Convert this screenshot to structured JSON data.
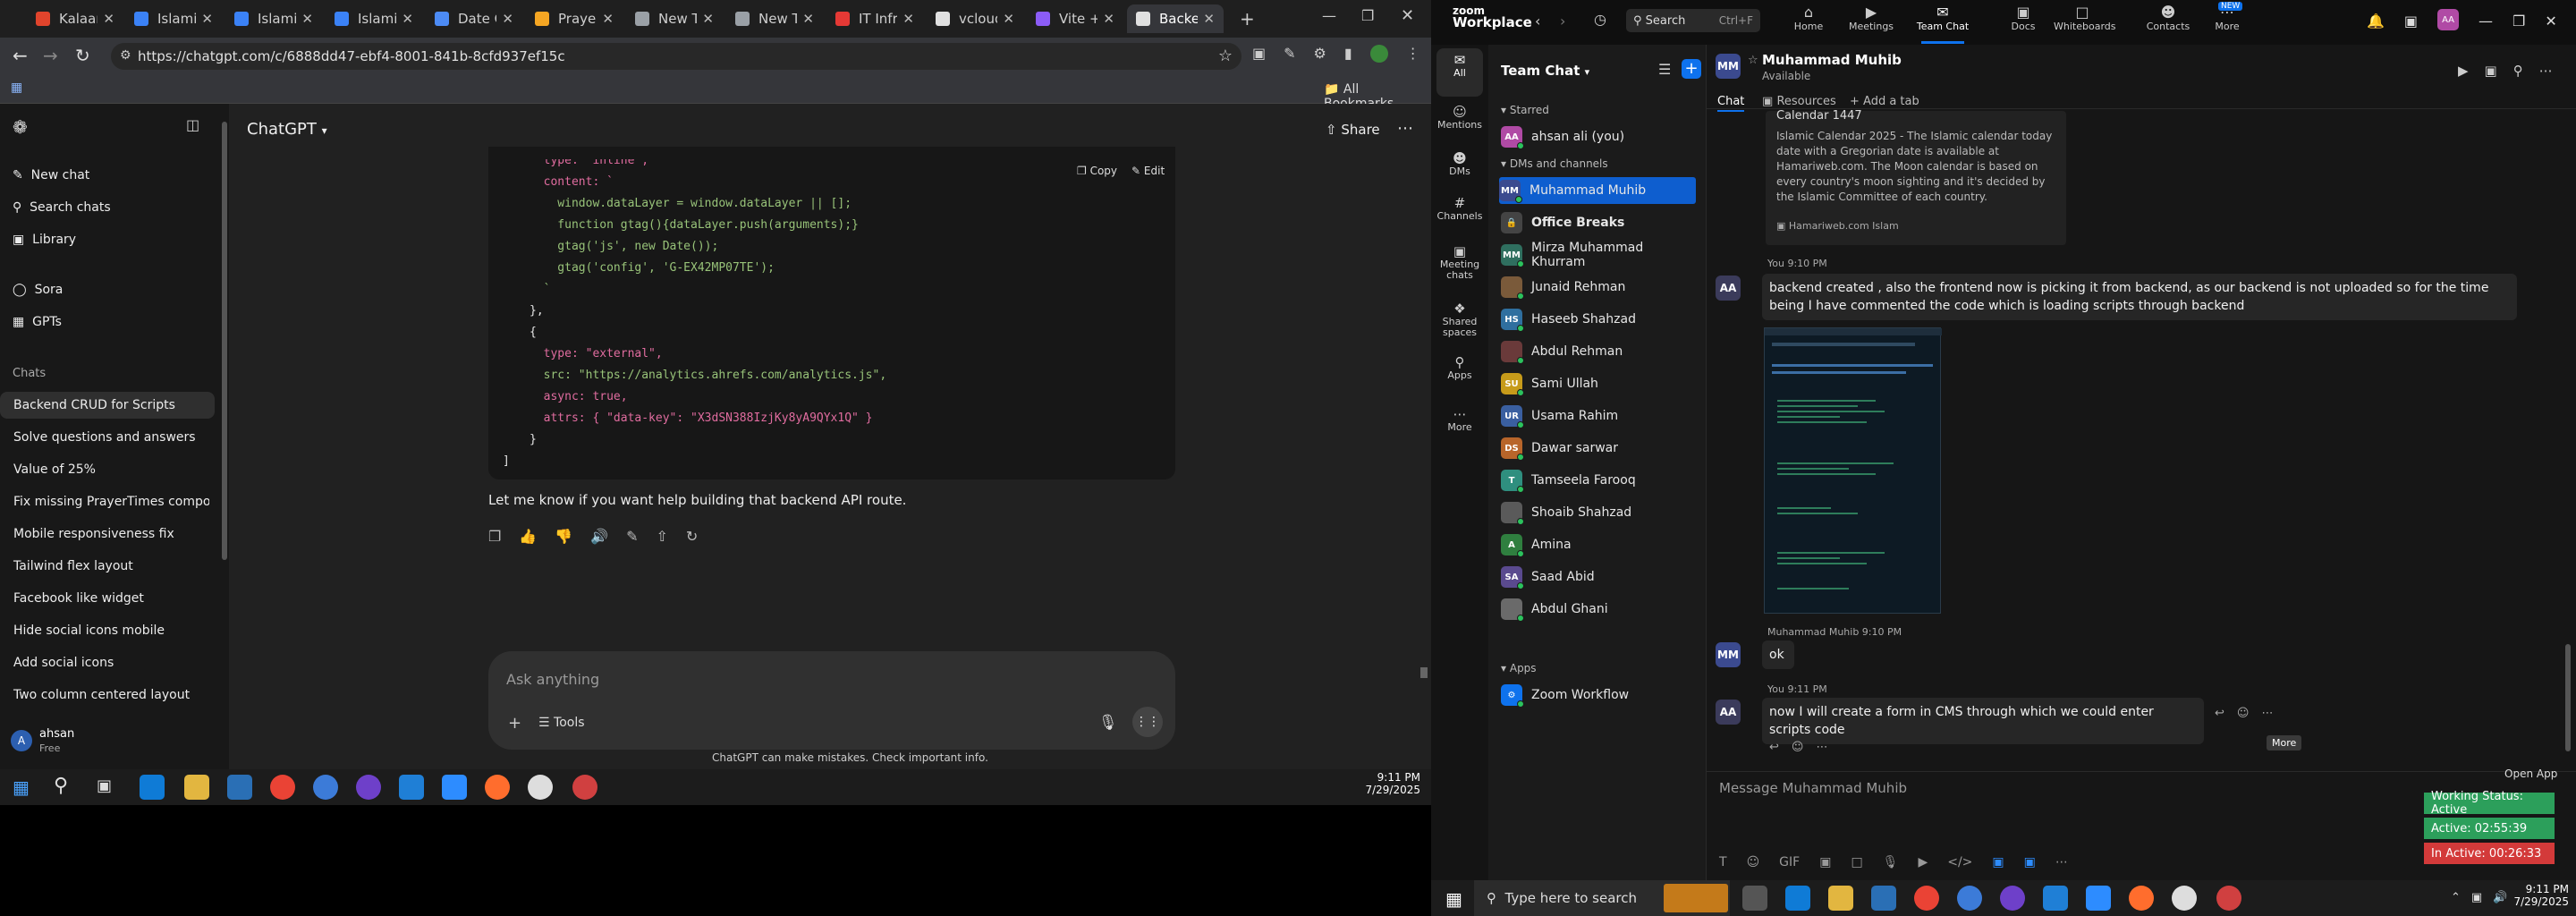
{
  "chrome": {
    "tabs": [
      {
        "label": "Kalaam",
        "color": "#e0442c"
      },
      {
        "label": "Islamic",
        "color": "#3b82f6"
      },
      {
        "label": "Islamic",
        "color": "#3b82f6"
      },
      {
        "label": "Islamic",
        "color": "#3b82f6"
      },
      {
        "label": "Date C",
        "color": "#4c8bf5"
      },
      {
        "label": "Prayer",
        "color": "#f5a623"
      },
      {
        "label": "New Ta",
        "color": "#9aa0a6"
      },
      {
        "label": "New Ta",
        "color": "#9aa0a6"
      },
      {
        "label": "IT Infra",
        "color": "#e53935"
      },
      {
        "label": "vcloud",
        "color": "#e0e0e0"
      },
      {
        "label": "Vite +",
        "color": "#8b5cf6"
      },
      {
        "label": "Backen",
        "color": "#e0e0e0"
      }
    ],
    "new_tab": "+",
    "url": "https://chatgpt.com/c/6888dd47-ebf4-8001-841b-8cfd937ef15c",
    "all_bookmarks": "All Bookmarks"
  },
  "chatgpt": {
    "sidebar": {
      "new_chat": "New chat",
      "search_chats": "Search chats",
      "library": "Library",
      "sora": "Sora",
      "gpts": "GPTs",
      "chats_header": "Chats",
      "chats": [
        "Backend CRUD for Scripts",
        "Solve questions and answers",
        "Value of 25%",
        "Fix missing PrayerTimes compon...",
        "Mobile responsiveness fix",
        "Tailwind flex layout",
        "Facebook like widget",
        "Hide social icons mobile",
        "Add social icons",
        "Two column centered layout"
      ],
      "user_initial": "A",
      "user_name": "ahsan",
      "user_plan": "Free"
    },
    "header_title": "ChatGPT",
    "share": "Share",
    "copy": "Copy",
    "edit": "Edit",
    "code_lines": [
      {
        "t": "  type: \"inline\",",
        "c": "#e06c9f"
      },
      {
        "t": "  content: `",
        "c": "#e06c9f"
      },
      {
        "t": "    window.dataLayer = window.dataLayer || [];",
        "c": "#98c379"
      },
      {
        "t": "    function gtag(){dataLayer.push(arguments);}",
        "c": "#98c379"
      },
      {
        "t": "    gtag('js', new Date());",
        "c": "#98c379"
      },
      {
        "t": "    gtag('config', 'G-EX42MP07TE');",
        "c": "#98c379"
      },
      {
        "t": "  `",
        "c": "#98c379"
      },
      {
        "t": "},",
        "c": "#e6e6e6"
      },
      {
        "t": "{",
        "c": "#e6e6e6"
      },
      {
        "t": "  type: \"external\",",
        "c": "#e06c9f"
      },
      {
        "t": "  src: \"https://analytics.ahrefs.com/analytics.js\",",
        "c": "#98c379"
      },
      {
        "t": "  async: true,",
        "c": "#e06c9f"
      },
      {
        "t": "  attrs: { \"data-key\": \"X3dSN388IzjKy8yA9QYx1Q\" }",
        "c": "#e06c9f"
      },
      {
        "t": "}",
        "c": "#e6e6e6"
      }
    ],
    "closing_bracket": "]",
    "reply": "Let me know if you want help building that backend API route.",
    "composer_placeholder": "Ask anything",
    "tools": "Tools",
    "disclaimer": "ChatGPT can make mistakes. Check important info."
  },
  "taskbar_left": {
    "time": "9:11 PM",
    "date": "7/29/2025"
  },
  "zoom": {
    "brand_top": "zoom",
    "brand_bottom": "Workplace",
    "search": "Search",
    "search_shortcut": "Ctrl+F",
    "nav": [
      "Home",
      "Meetings",
      "Team Chat",
      "Docs",
      "Whiteboards",
      "Contacts",
      "More"
    ],
    "new_badge": "NEW",
    "rail": [
      "All",
      "Mentions",
      "DMs",
      "Channels",
      "Meeting chats",
      "Shared spaces",
      "Apps",
      "More"
    ],
    "panel_title": "Team Chat",
    "starred": "Starred",
    "self_contact": "ahsan ali (you)",
    "dms_header": "DMs and channels",
    "contacts": [
      {
        "name": "Muhammad Muhib",
        "init": "MM",
        "color": "#3b4a8f"
      },
      {
        "name": "Office Breaks",
        "init": "",
        "color": "#444"
      },
      {
        "name": "Mirza Muhammad Khurram",
        "init": "MM",
        "color": "#2f6f5f"
      },
      {
        "name": "Junaid Rehman",
        "init": "",
        "color": "#7a5a3a"
      },
      {
        "name": "Haseeb Shahzad",
        "init": "HS",
        "color": "#2f6f9f"
      },
      {
        "name": "Abdul Rehman",
        "init": "",
        "color": "#6a3a3a"
      },
      {
        "name": "Sami Ullah",
        "init": "SU",
        "color": "#c79b1a"
      },
      {
        "name": "Usama Rahim",
        "init": "UR",
        "color": "#3a5fa0"
      },
      {
        "name": "Dawar sarwar",
        "init": "DS",
        "color": "#b8652a"
      },
      {
        "name": "Tamseela Farooq",
        "init": "T",
        "color": "#2f8f7f"
      },
      {
        "name": "Shoaib Shahzad",
        "init": "",
        "color": "#5a5a5a"
      },
      {
        "name": "Amina",
        "init": "A",
        "color": "#2f7f3f"
      },
      {
        "name": "Saad Abid",
        "init": "SA",
        "color": "#5a4a8f"
      },
      {
        "name": "Abdul Ghani",
        "init": "",
        "color": "#6a6a6a"
      }
    ],
    "apps_header": "Apps",
    "zoom_workflow": "Zoom Workflow",
    "chat_header_name": "Muhammad Muhib",
    "chat_header_status": "Available",
    "chat_tab": "Chat",
    "resources_tab": "Resources",
    "add_tab": "Add a tab",
    "link_card_title": "Calendar 1447",
    "link_card_text": "Islamic Calendar 2025 - The Islamic calendar today date with a Gregorian date is available at Hamariweb.com. The Moon calendar is based on every country's moon sighting and it's decided by the Islamic Committee of each country.",
    "link_card_source": "Hamariweb.com Islam",
    "msg1_meta": "You 9:10 PM",
    "msg1_text": "backend created , also the frontend now is picking it from backend, as our backend is not uploaded so for the time being I have commented the code which is loading scripts through backend",
    "msg2_meta": "Muhammad Muhib 9:10 PM",
    "msg2_text": "ok",
    "msg3_meta": "You 9:11 PM",
    "msg3_text": "now I will create a form in CMS through which we could enter scripts code",
    "more_tooltip": "More",
    "compose_placeholder": "Message Muhammad Muhib",
    "open_app": "Open App",
    "working_status": "Working Status: Active",
    "active_time": "Active: 02:55:39",
    "inactive_time": "In Active: 00:26:33"
  },
  "taskbar_right": {
    "search_placeholder": "Type here to search",
    "time": "9:11 PM",
    "date": "7/29/2025"
  }
}
